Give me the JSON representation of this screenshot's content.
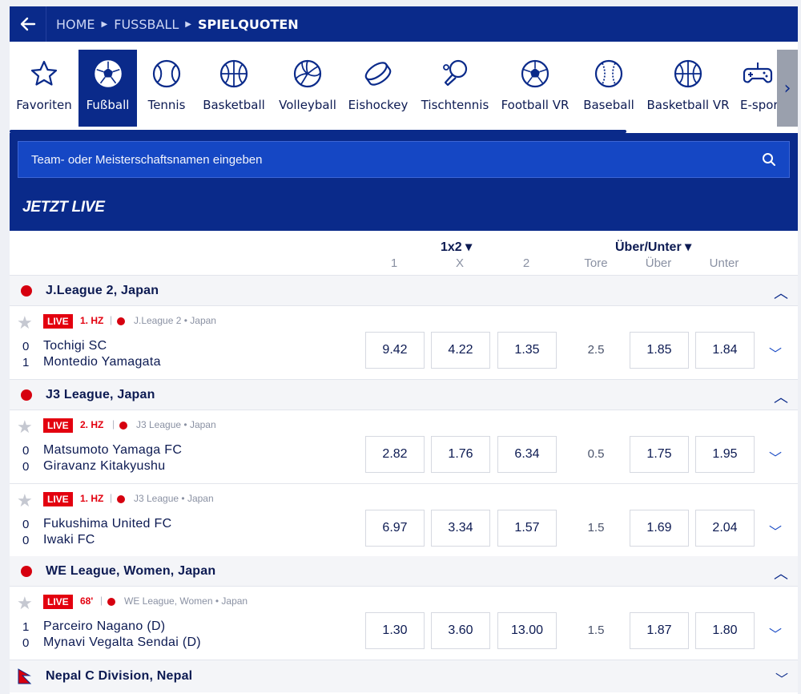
{
  "breadcrumb": {
    "back_icon": "arrow-left-icon",
    "items": [
      "HOME",
      "FUSSBALL",
      "SPIELQUOTEN"
    ]
  },
  "sports": [
    {
      "label": "Favoriten",
      "icon": "star-icon",
      "active": false
    },
    {
      "label": "Fußball",
      "icon": "soccer-ball-icon",
      "active": true
    },
    {
      "label": "Tennis",
      "icon": "tennis-ball-icon",
      "active": false
    },
    {
      "label": "Basketball",
      "icon": "basketball-icon",
      "active": false
    },
    {
      "label": "Volleyball",
      "icon": "volleyball-icon",
      "active": false
    },
    {
      "label": "Eishockey",
      "icon": "hockey-puck-icon",
      "active": false
    },
    {
      "label": "Tischtennis",
      "icon": "table-tennis-icon",
      "active": false
    },
    {
      "label": "Football VR",
      "icon": "soccer-ball-icon",
      "active": false
    },
    {
      "label": "Baseball",
      "icon": "baseball-icon",
      "active": false
    },
    {
      "label": "Basketball VR",
      "icon": "basketball-icon",
      "active": false
    },
    {
      "label": "E-sports +",
      "icon": "gamepad-icon",
      "active": false
    }
  ],
  "search": {
    "placeholder": "Team- oder Meisterschaftsnamen eingeben"
  },
  "live_header": "JETZT LIVE",
  "columns": {
    "market1": "1x2 ▾",
    "market2": "Über/Unter ▾",
    "c1": "1",
    "cx": "X",
    "c2": "2",
    "tore": "Tore",
    "uber": "Über",
    "unter": "Unter"
  },
  "leagues": [
    {
      "name": "J.League 2, Japan",
      "events": [
        {
          "live": "LIVE",
          "period": "1. HZ",
          "competition": "J.League 2",
          "country": "Japan",
          "home": "Tochigi SC",
          "away": "Montedio Yamagata",
          "home_score": "0",
          "away_score": "1",
          "odds": [
            "9.42",
            "4.22",
            "1.35"
          ],
          "tore": "2.5",
          "over": "1.85",
          "under": "1.84"
        }
      ]
    },
    {
      "name": "J3 League, Japan",
      "events": [
        {
          "live": "LIVE",
          "period": "2. HZ",
          "competition": "J3 League",
          "country": "Japan",
          "home": "Matsumoto Yamaga FC",
          "away": "Giravanz Kitakyushu",
          "home_score": "0",
          "away_score": "0",
          "odds": [
            "2.82",
            "1.76",
            "6.34"
          ],
          "tore": "0.5",
          "over": "1.75",
          "under": "1.95"
        },
        {
          "live": "LIVE",
          "period": "1. HZ",
          "competition": "J3 League",
          "country": "Japan",
          "home": "Fukushima United FC",
          "away": "Iwaki FC",
          "home_score": "0",
          "away_score": "0",
          "odds": [
            "6.97",
            "3.34",
            "1.57"
          ],
          "tore": "1.5",
          "over": "1.69",
          "under": "2.04"
        }
      ]
    },
    {
      "name": "WE League, Women, Japan",
      "events": [
        {
          "live": "LIVE",
          "period": "68'",
          "competition": "WE League, Women",
          "country": "Japan",
          "home": "Parceiro Nagano (D)",
          "away": "Mynavi Vegalta Sendai (D)",
          "home_score": "1",
          "away_score": "0",
          "odds": [
            "1.30",
            "3.60",
            "13.00"
          ],
          "tore": "1.5",
          "over": "1.87",
          "under": "1.80"
        }
      ]
    }
  ],
  "collapsed_league": {
    "name": "Nepal C Division, Nepal"
  },
  "colors": {
    "primary": "#0a2a8a",
    "live_red": "#e3000f",
    "accent": "#1547c4"
  }
}
